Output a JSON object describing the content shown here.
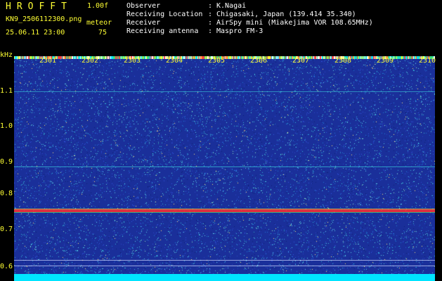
{
  "header": {
    "app_title": "HROFFT",
    "version": "1.00f",
    "filename": "KN9_2506112300.png",
    "meteor_label": "meteor",
    "datetime": "25.06.11 23:00",
    "meteor_count": "75"
  },
  "info": [
    {
      "key": "Observer",
      "value": "K.Nagai"
    },
    {
      "key": "Receiving Location",
      "value": "Chigasaki, Japan (139.414 35.340)"
    },
    {
      "key": "Receiver",
      "value": "AirSpy mini (Miakejima VOR 108.65MHz)"
    },
    {
      "key": "Receiving antenna",
      "value": "Maspro FM-3"
    }
  ],
  "axis": {
    "unit": "kHz",
    "y_ticks": [
      "1.1",
      "1.0",
      "0.9",
      "0.8",
      "0.7",
      "0.6"
    ],
    "x_ticks": [
      "2301",
      "2302",
      "2303",
      "2304",
      "2305",
      "2306",
      "2307",
      "2308",
      "2309",
      "2310"
    ]
  },
  "colors": {
    "background": "#1a2f9a",
    "label": "#ffff33",
    "signal": "#ff3030",
    "baseline": "#00e5ff"
  }
}
